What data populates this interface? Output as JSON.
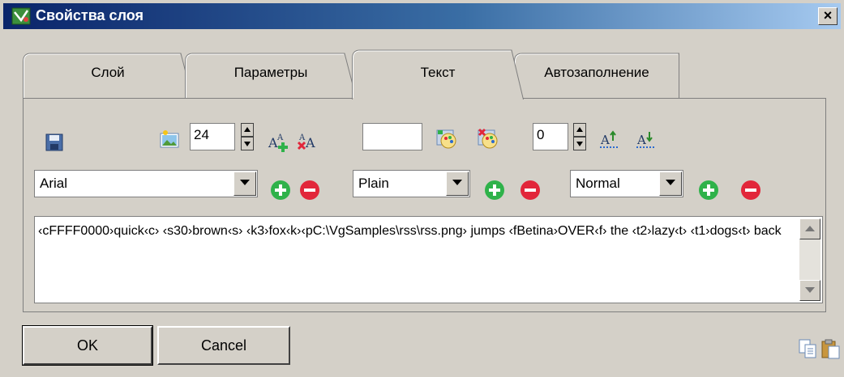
{
  "window": {
    "title": "Свойства слоя",
    "close_label": "×"
  },
  "tabs": [
    {
      "label": "Слой"
    },
    {
      "label": "Параметры"
    },
    {
      "label": "Текст"
    },
    {
      "label": "Автозаполнение"
    }
  ],
  "active_tab": "Текст",
  "toolbar": {
    "font_size": "24",
    "color_value": "",
    "spacing_value": "0"
  },
  "font_row": {
    "font_family": "Arial",
    "style": "Plain",
    "weight": "Normal"
  },
  "text": {
    "content": "‹cFFFF0000›quick‹c› ‹s30›brown‹s› ‹k3›fox‹k›‹pC:\\VgSamples\\rss\\rss.png› jumps ‹fBetina›OVER‹f› the ‹t2›lazy‹t› ‹t1›dogs‹t› back"
  },
  "buttons": {
    "ok": "OK",
    "cancel": "Cancel"
  },
  "colors": {
    "titlebar_start": "#0a246a",
    "titlebar_end": "#a6caf0",
    "add_green": "#2fb24a",
    "remove_red": "#e2263a",
    "face": "#d4d0c8"
  },
  "icons": [
    "save-icon",
    "image-icon",
    "increase-font-icon",
    "decrease-font-icon",
    "color-pick-icon",
    "color-remove-icon",
    "underline-up-icon",
    "underline-down-icon",
    "add-icon",
    "remove-icon",
    "copy-icon",
    "paste-icon"
  ]
}
